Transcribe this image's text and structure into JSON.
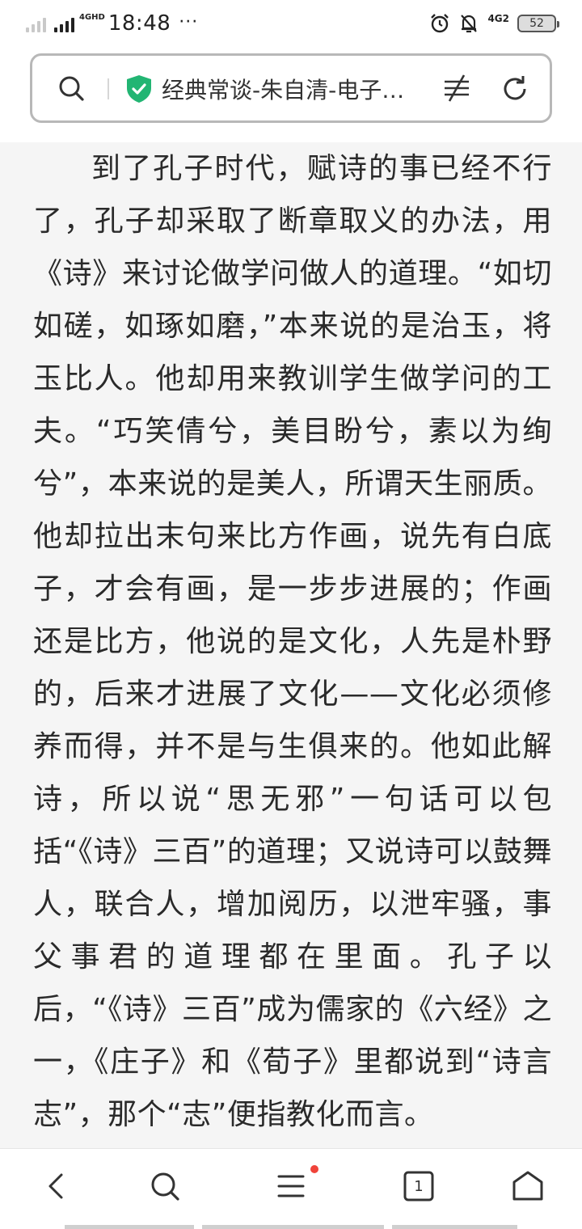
{
  "status_bar": {
    "network_left": "4GHD",
    "time": "18:48",
    "more": "···",
    "network_right": "4G2",
    "battery": "52"
  },
  "address_bar": {
    "title": "经典常谈-朱自清-电子…",
    "secure_color": "#22b573"
  },
  "article": {
    "text": "到了孔子时代，赋诗的事已经不行了，孔子却采取了断章取义的办法，用《诗》来讨论做学问做人的道理。“如切如磋，如琢如磨，”本来说的是治玉，将玉比人。他却用来教训学生做学问的工夫。“巧笑倩兮，美目盼兮，素以为绚兮”，本来说的是美人，所谓天生丽质。他却拉出末句来比方作画，说先有白底子，才会有画，是一步步进展的；作画还是比方，他说的是文化，人先是朴野的，后来才进展了文化——文化必须修养而得，并不是与生俱来的。他如此解诗，所以说“思无邪”一句话可以包括“《诗》三百”的道理；又说诗可以鼓舞人，联合人，增加阅历，以泄牢骚，事父事君的道理都在里面。孔子以后，“《诗》三百”成为儒家的《六经》之一，《庄子》和《荀子》里都说到“诗言志”，那个“志”便指教化而言。"
  },
  "bottom_nav": {
    "tab_count": "1",
    "menu_badge_color": "#f0433a"
  }
}
